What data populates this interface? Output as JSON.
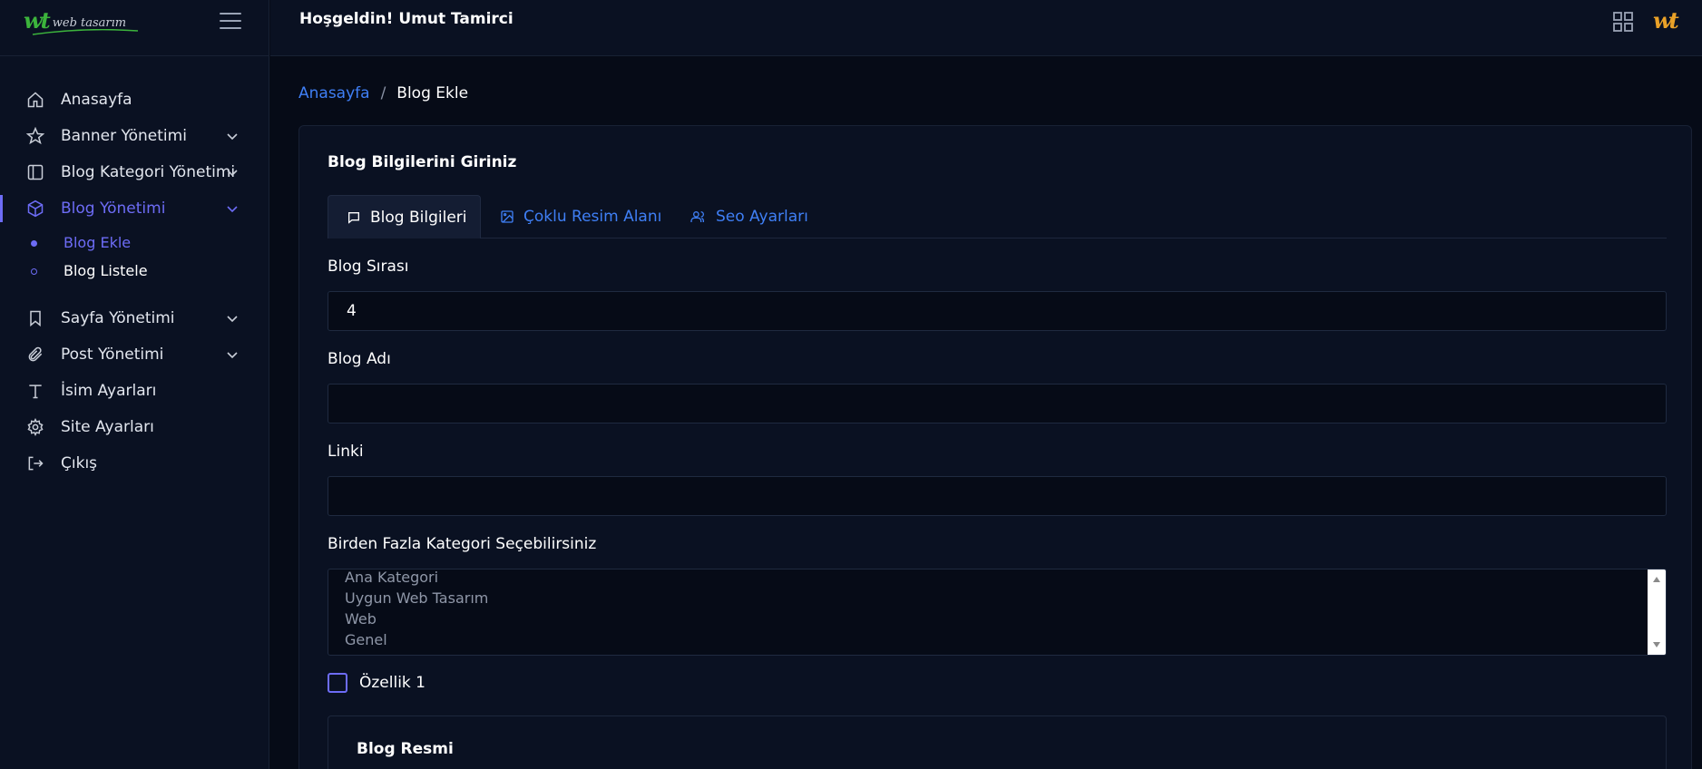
{
  "brand": {
    "logo_mark": "wt",
    "logo_text": "web tasarım"
  },
  "header": {
    "welcome": "Hoşgeldin! Umut Tamirci",
    "avatar_text": "wt"
  },
  "sidebar": {
    "items": [
      {
        "label": "Anasayfa",
        "icon": "home-icon"
      },
      {
        "label": "Banner Yönetimi",
        "icon": "star-icon",
        "expandable": true
      },
      {
        "label": "Blog Kategori Yönetimi",
        "icon": "layout-icon",
        "expandable": true
      },
      {
        "label": "Blog Yönetimi",
        "icon": "box-icon",
        "expandable": true,
        "active": true
      },
      {
        "label": "Sayfa Yönetimi",
        "icon": "bookmark-icon",
        "expandable": true
      },
      {
        "label": "Post Yönetimi",
        "icon": "paperclip-icon",
        "expandable": true
      },
      {
        "label": "İsim Ayarları",
        "icon": "type-icon"
      },
      {
        "label": "Site Ayarları",
        "icon": "settings-icon"
      },
      {
        "label": "Çıkış",
        "icon": "logout-icon"
      }
    ],
    "subitems": [
      {
        "label": "Blog Ekle",
        "active": true
      },
      {
        "label": "Blog Listele",
        "active": false
      }
    ],
    "accent_color": "#6d6cf6"
  },
  "breadcrumb": {
    "home": "Anasayfa",
    "separator": "/",
    "current": "Blog Ekle"
  },
  "card": {
    "title": "Blog Bilgilerini Giriniz",
    "tabs": [
      {
        "label": "Blog Bilgileri",
        "icon": "message-icon",
        "active": true
      },
      {
        "label": "Çoklu Resim Alanı",
        "icon": "image-icon",
        "active": false
      },
      {
        "label": "Seo Ayarları",
        "icon": "users-icon",
        "active": false
      }
    ],
    "fields": {
      "sira": {
        "label": "Blog Sırası",
        "value": "4"
      },
      "adi": {
        "label": "Blog Adı",
        "value": ""
      },
      "linki": {
        "label": "Linki",
        "value": ""
      }
    },
    "category": {
      "label": "Birden Fazla Kategori Seçebilirsiniz",
      "options": [
        "Ana Kategori",
        "Uygun Web Tasarım",
        "Web",
        "Genel"
      ]
    },
    "checkbox": {
      "label": "Özellik 1",
      "checked": false
    },
    "image_section": {
      "title": "Blog Resmi"
    }
  },
  "colors": {
    "link": "#3f7ff5",
    "background": "#060b17",
    "panel": "#0a1122"
  }
}
